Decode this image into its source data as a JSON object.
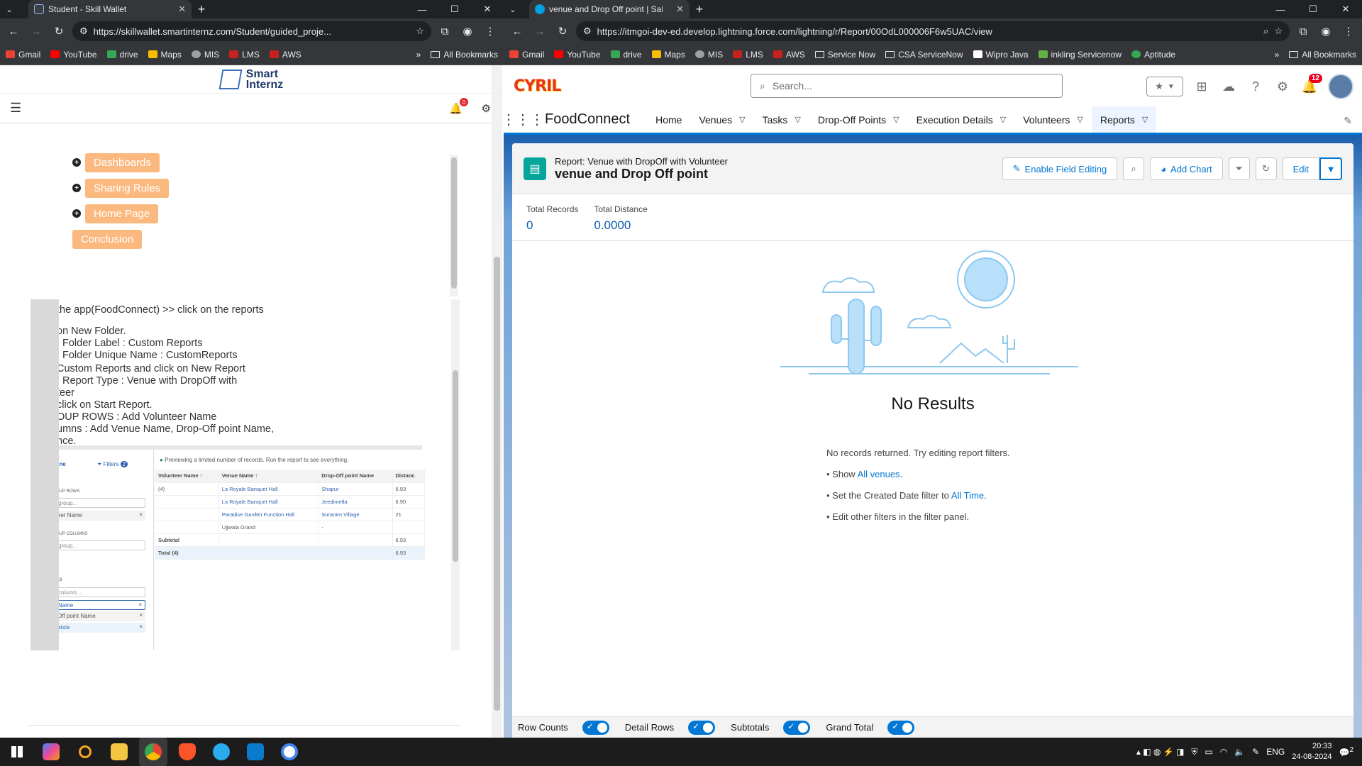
{
  "left_window": {
    "tab_title": "Student - Skill Wallet",
    "url": "https://skillwallet.smartinternz.com/Student/guided_proje...",
    "bookmarks": [
      "Gmail",
      "YouTube",
      "drive",
      "Maps",
      "MIS",
      "LMS",
      "AWS"
    ],
    "all_bookmarks": "All Bookmarks",
    "logo_line1": "Smart",
    "logo_line2": "Internz",
    "notif_count": "0",
    "steps": [
      "Dashboards",
      "Sharing Rules",
      "Home Page",
      "Conclusion"
    ],
    "instructions": [
      "the app(FoodConnect)  >>  click on the reports",
      "on New Folder.",
      "  Folder Label : Custom Reports",
      "  Folder Unique Name : CustomReports",
      " Custom Reports and click on New Report",
      ": Report Type : Venue with DropOff with",
      "teer",
      "click on Start Report.",
      "OUP ROWS : Add Volunteer Name",
      "umns : Add Venue Name, Drop-Off point Name,",
      "nce."
    ],
    "shot": {
      "outline": "line",
      "filters": "Filters",
      "filters_count": "2",
      "group_rows": "OUP ROWS",
      "group_columns": "OUP COLUMNS",
      "group_placeholder": "group...",
      "group_row_item": "eer Name",
      "columns": "ns",
      "column_placeholder": "column...",
      "col_items": [
        "Name",
        "Off point Name",
        "ance"
      ],
      "preview_note": "Previewing a limited number of records. Run the report to see everything.",
      "headers": [
        "Volunteer Name ↑",
        "Venue Name ↑",
        "Drop-Off point Name",
        "Distanc"
      ],
      "group_count": "(4)",
      "rows": [
        [
          "La Royale Banquet Hall",
          "Shapur",
          "6.93"
        ],
        [
          "La Royale Banquet Hall",
          "Jeedimetla",
          "6.90"
        ],
        [
          "Paradise Garden Function Hall",
          "Suraram Village",
          "21"
        ],
        [
          "Ujjwala Grand",
          "-",
          ""
        ]
      ],
      "subtotal": "Subtotal",
      "subtotal_val": "6.93",
      "total": "Total",
      "total_count": "(4)",
      "total_val": "6.93"
    }
  },
  "right_window": {
    "tab_title": "venue and Drop Off point | Sale",
    "url": "https://itmgoi-dev-ed.develop.lightning.force.com/lightning/r/Report/00OdL000006F6w5UAC/view",
    "bookmarks": [
      "Gmail",
      "YouTube",
      "drive",
      "Maps",
      "MIS",
      "LMS",
      "AWS",
      "Service Now",
      "CSA ServiceNow",
      "Wipro Java",
      "inkling Servicenow",
      "Aptitude"
    ],
    "all_bookmarks": "All Bookmarks",
    "logo_text": "CYRIL",
    "search_placeholder": "Search...",
    "notif_count": "12",
    "app_name": "FoodConnect",
    "nav": [
      "Home",
      "Venues",
      "Tasks",
      "Drop-Off Points",
      "Execution Details",
      "Volunteers",
      "Reports"
    ],
    "report_type_label": "Report: Venue with DropOff with Volunteer",
    "report_title": "venue and Drop Off point",
    "btn_field_editing": "Enable Field Editing",
    "btn_add_chart": "Add Chart",
    "btn_edit": "Edit",
    "total_records_label": "Total Records",
    "total_records": "0",
    "total_distance_label": "Total Distance",
    "total_distance": "0.0000",
    "no_results": "No Results",
    "msg1": "No records returned. Try editing report filters.",
    "msg2_prefix": "• Show ",
    "msg2_link": "All venues",
    "msg2_suffix": ".",
    "msg3_prefix": "• Set the Created Date filter to ",
    "msg3_link": "All Time",
    "msg3_suffix": ".",
    "msg4": "• Edit other filters in the filter panel.",
    "footer": [
      "Row Counts",
      "Detail Rows",
      "Subtotals",
      "Grand Total"
    ]
  },
  "taskbar": {
    "lang": "ENG",
    "time": "20:33",
    "date": "24-08-2024",
    "notif": "2"
  }
}
